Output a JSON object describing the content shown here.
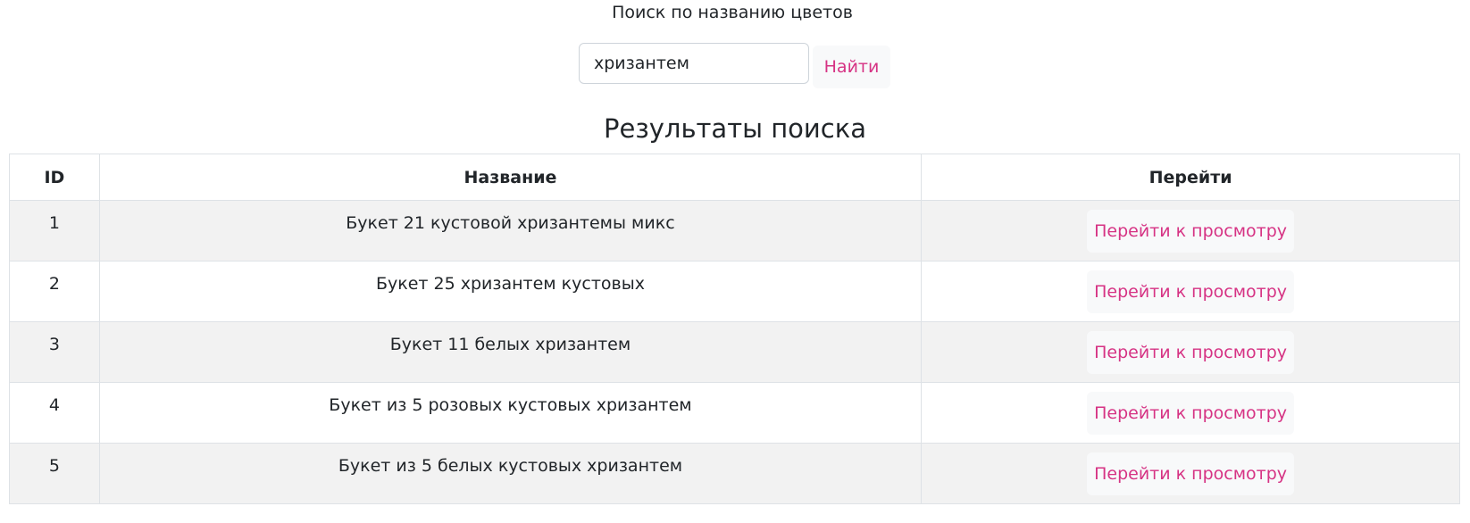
{
  "search": {
    "label": "Поиск по названию цветов",
    "input_value": "хризантем",
    "button_label": "Найти"
  },
  "results": {
    "heading": "Результаты поиска",
    "columns": {
      "id": "ID",
      "name": "Название",
      "go": "Перейти"
    },
    "rows": [
      {
        "id": "1",
        "name": "Букет 21 кустовой хризантемы микс",
        "action": "Перейти к просмотру"
      },
      {
        "id": "2",
        "name": "Букет 25 хризантем кустовых",
        "action": "Перейти к просмотру"
      },
      {
        "id": "3",
        "name": "Букет 11 белых хризантем",
        "action": "Перейти к просмотру"
      },
      {
        "id": "4",
        "name": "Букет из 5 розовых кустовых хризантем",
        "action": "Перейти к просмотру"
      },
      {
        "id": "5",
        "name": "Букет из 5 белых кустовых хризантем",
        "action": "Перейти к просмотру"
      }
    ]
  },
  "colors": {
    "accent": "#d63384",
    "button_bg": "#f8f9fa",
    "stripe_bg": "#f2f2f2",
    "border": "#dee2e6"
  }
}
